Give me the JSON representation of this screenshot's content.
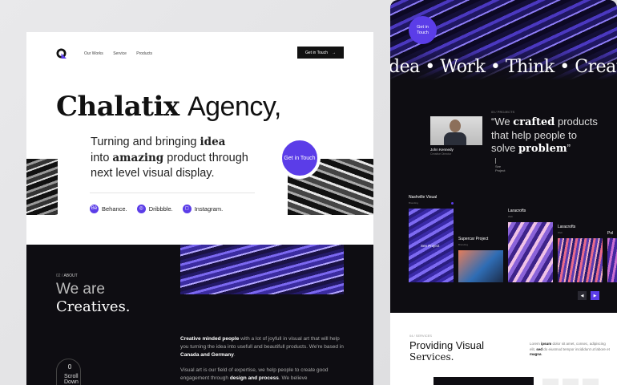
{
  "left": {
    "nav": {
      "links": [
        "Our Works",
        "Service",
        "Products"
      ],
      "cta": "Get in Touch",
      "cta_arrow": "→"
    },
    "hero": {
      "title_bold": "Chalatix",
      "title_light": "Agency,",
      "sub_1": "Turning and bringing ",
      "sub_idea": "idea",
      "sub_2": "into ",
      "sub_amazing": "amazing",
      "sub_3": " product through next level visual display.",
      "circle_cta": "Get in Touch",
      "socials": [
        {
          "label": "Behance.",
          "icon": "behance-icon"
        },
        {
          "label": "Dribbble.",
          "icon": "dribbble-icon"
        },
        {
          "label": "Instagram.",
          "icon": "instagram-icon"
        }
      ]
    },
    "about": {
      "tag_num": "02 /",
      "tag_label": "ABOUT",
      "title_1": "We are",
      "title_2": "Creatives.",
      "p1_bold": "Creative minded people",
      "p1_rest": " with a lot of joyfull in visual art that will help you turning the idea into usefull and beautifull products. We're based in ",
      "p1_place": "Canada and Germany",
      "p1_end": ".",
      "p2_start": "Visual art is our field of expertise, we help people to create good engagement through ",
      "p2_bold": "design and process",
      "p2_end": ". We believe",
      "scroll": "Scroll Down"
    }
  },
  "right": {
    "circle_cta": "Get in Touch",
    "marquee": [
      "dea",
      "Work",
      "Think",
      "Creative"
    ],
    "person": {
      "name": "John Kennedy",
      "role": "Creative Director"
    },
    "projects": {
      "tag": "03 / PROJECTS",
      "quote_1": "“We ",
      "quote_bold1": "crafted",
      "quote_2": " products that help people to solve ",
      "quote_bold2": "problem",
      "quote_3": "”",
      "see": "See Project"
    },
    "gallery": [
      {
        "title": "Nashville Visual",
        "sub": "Branding",
        "see": "See Project"
      },
      {
        "title": "Supercar Project",
        "sub": "Branding"
      },
      {
        "title": "Laracrofts",
        "sub": "Web"
      },
      {
        "title": "Laracrofts",
        "sub": "Web"
      },
      {
        "title": "Pol",
        "sub": "Web"
      }
    ],
    "pager": {
      "prev": "◀",
      "next": "▶"
    },
    "services": {
      "tag": "04 / SERVICES",
      "title_1": "Providing Visual",
      "title_2": "Services.",
      "p_1": "Lorem ",
      "p_b1": "ipsum",
      "p_2": " dolor sit amet, consec, adipiscing elit, ",
      "p_b2": "sed",
      "p_3": " do eiusmod tempor incididunt ut labore et ",
      "p_b3": "magna",
      "p_4": "."
    }
  },
  "colors": {
    "accent": "#5b3de8",
    "dark": "#0e0d12"
  }
}
